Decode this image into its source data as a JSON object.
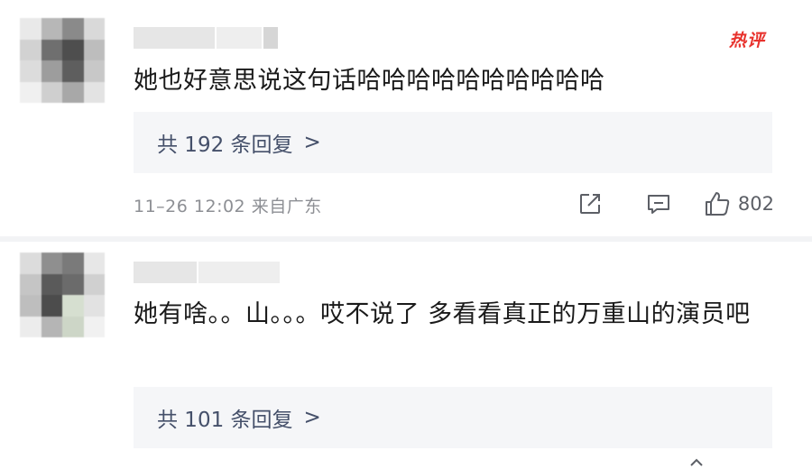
{
  "comments": [
    {
      "badge": "热评",
      "text": "她也好意思说这句话哈哈哈哈哈哈哈哈哈哈",
      "replies_label": "共 192 条回复",
      "replies_chevron": ">",
      "meta": "11–26 12:02 来自广东",
      "likes": "802",
      "icons": {
        "share": "share-icon",
        "comment": "comment-icon",
        "like": "thumbs-up-icon"
      }
    },
    {
      "text": "她有啥。。山。。。哎不说了 多看看真正的万重山的演员吧",
      "replies_label": "共 101 条回复",
      "replies_chevron": ">"
    }
  ],
  "colors": {
    "badge_red": "#e8322d",
    "reply_bg": "#f5f6f8",
    "reply_text": "#45506a",
    "meta_gray": "#8d8f94"
  }
}
